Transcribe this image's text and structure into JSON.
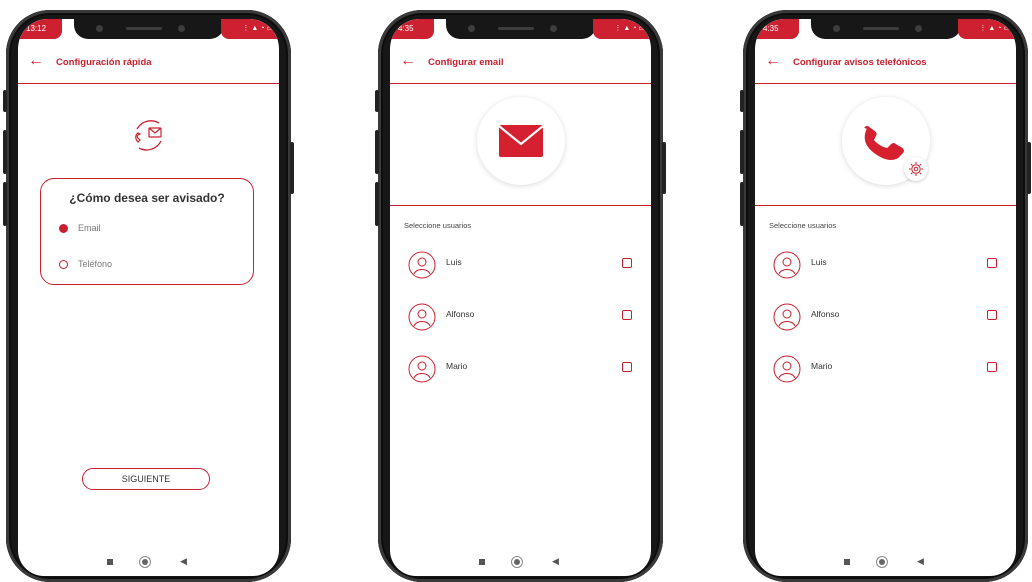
{
  "colors": {
    "accent": "#c8202e"
  },
  "phone1": {
    "status_time": "13:12",
    "status_icons": "⋮ ▲ ◔ ▭",
    "title": "Configuración rápida",
    "icon": "contact-call-email-icon",
    "question": "¿Cómo desea ser avisado?",
    "options": [
      {
        "label": "Email",
        "selected": true
      },
      {
        "label": "Teléfono",
        "selected": false
      }
    ],
    "next_label": "SIGUIENTE"
  },
  "phone2": {
    "status_time": "4:35",
    "status_icons": "⋮ ▲ ◔ ▭",
    "title": "Configurar email",
    "hero_icon": "envelope-icon",
    "section_label": "Seleccione usuarios",
    "users": [
      {
        "name": "Luis",
        "checked": false
      },
      {
        "name": "Alfonso",
        "checked": false
      },
      {
        "name": "Mario",
        "checked": false
      }
    ]
  },
  "phone3": {
    "status_time": "4:35",
    "status_icons": "⋮ ▲ ◔ ▭",
    "title": "Configurar avisos telefónicos",
    "hero_icon": "phone-handset-icon",
    "section_label": "Seleccione usuarios",
    "users": [
      {
        "name": "Luis",
        "checked": false
      },
      {
        "name": "Alfonso",
        "checked": false
      },
      {
        "name": "Mario",
        "checked": false
      }
    ]
  }
}
